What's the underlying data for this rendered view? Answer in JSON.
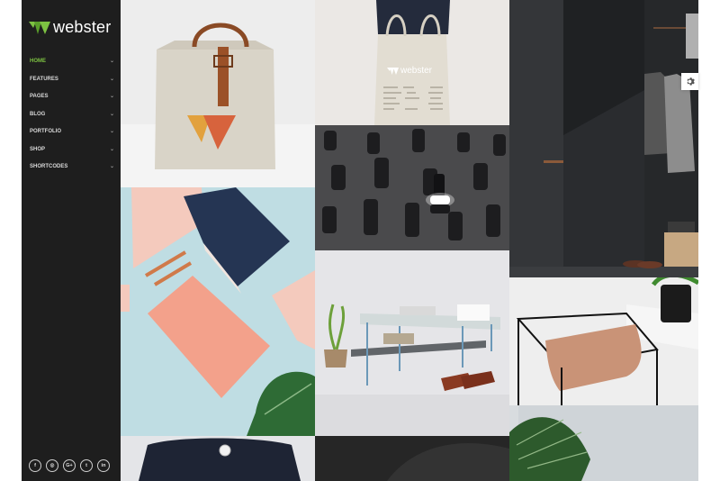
{
  "brand": {
    "name": "webster",
    "accent": "#7dc242"
  },
  "nav": {
    "items": [
      {
        "label": "HOME",
        "active": true
      },
      {
        "label": "FEATURES"
      },
      {
        "label": "PAGES"
      },
      {
        "label": "BLOG"
      },
      {
        "label": "PORTFOLIO"
      },
      {
        "label": "SHOP"
      },
      {
        "label": "SHORTCODES"
      }
    ],
    "chevron": "⌄"
  },
  "social": [
    "f",
    "◎",
    "G+",
    "t",
    "in"
  ],
  "bag": {
    "brand": "webster"
  },
  "icons": {
    "settings": "gear-icon"
  }
}
